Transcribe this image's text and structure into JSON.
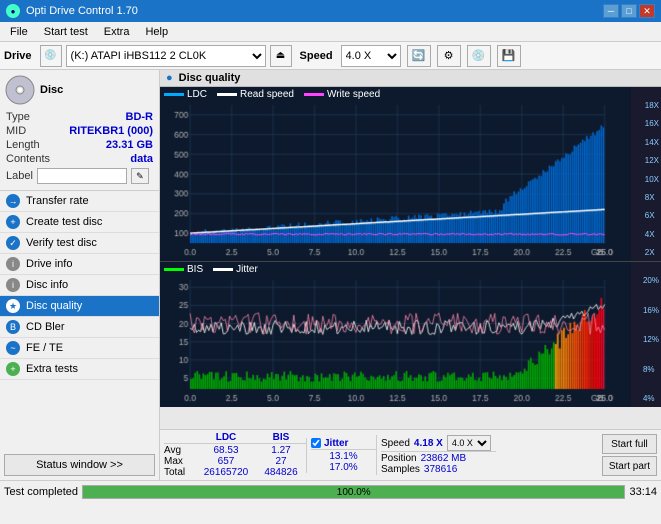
{
  "app": {
    "title": "Opti Drive Control 1.70",
    "logo": "●"
  },
  "title_buttons": [
    "─",
    "□",
    "✕"
  ],
  "menu": {
    "items": [
      "File",
      "Start test",
      "Extra",
      "Help"
    ]
  },
  "drive_bar": {
    "label": "Drive",
    "drive_value": "(K:) ATAPI iHBS112  2 CL0K",
    "speed_label": "Speed",
    "speed_value": "4.0 X"
  },
  "disc": {
    "type_label": "Type",
    "type_value": "BD-R",
    "mid_label": "MID",
    "mid_value": "RITEKBR1 (000)",
    "length_label": "Length",
    "length_value": "23.31 GB",
    "contents_label": "Contents",
    "contents_value": "data",
    "label_label": "Label",
    "label_placeholder": ""
  },
  "nav": {
    "items": [
      {
        "label": "Transfer rate",
        "icon": "→",
        "active": false
      },
      {
        "label": "Create test disc",
        "icon": "+",
        "active": false
      },
      {
        "label": "Verify test disc",
        "icon": "✓",
        "active": false
      },
      {
        "label": "Drive info",
        "icon": "i",
        "active": false
      },
      {
        "label": "Disc info",
        "icon": "i",
        "active": false
      },
      {
        "label": "Disc quality",
        "icon": "★",
        "active": true
      },
      {
        "label": "CD Bler",
        "icon": "B",
        "active": false
      },
      {
        "label": "FE / TE",
        "icon": "~",
        "active": false
      },
      {
        "label": "Extra tests",
        "icon": "+",
        "active": false
      }
    ],
    "status_button": "Status window >>"
  },
  "panel": {
    "title": "Disc quality",
    "icon": "●",
    "legend_top": [
      {
        "label": "LDC",
        "color": "#00aaff"
      },
      {
        "label": "Read speed",
        "color": "#ffffff"
      },
      {
        "label": "Write speed",
        "color": "#ff44ff"
      }
    ],
    "legend_bottom": [
      {
        "label": "BIS",
        "color": "#00ff00"
      },
      {
        "label": "Jitter",
        "color": "#ffffff"
      }
    ],
    "y_axis_top": [
      "18X",
      "16X",
      "14X",
      "12X",
      "10X",
      "8X",
      "6X",
      "4X",
      "2X"
    ],
    "y_axis_bottom": [
      "20%",
      "16%",
      "12%",
      "8%",
      "4%"
    ]
  },
  "stats": {
    "columns": [
      "LDC",
      "BIS"
    ],
    "jitter_label": "Jitter",
    "jitter_checked": true,
    "speed_label": "Speed",
    "speed_value": "4.18 X",
    "speed_select": "4.0 X",
    "rows": [
      {
        "label": "Avg",
        "ldc": "68.53",
        "bis": "1.27",
        "jitter": "13.1%"
      },
      {
        "label": "Max",
        "ldc": "657",
        "bis": "27",
        "jitter": "17.0%"
      },
      {
        "label": "Total",
        "ldc": "26165720",
        "bis": "484826",
        "jitter": ""
      }
    ],
    "position_label": "Position",
    "position_value": "23862 MB",
    "samples_label": "Samples",
    "samples_value": "378616",
    "start_full": "Start full",
    "start_part": "Start part"
  },
  "status_bar": {
    "text": "Test completed",
    "progress": 100,
    "progress_text": "100.0%",
    "time": "33:14"
  }
}
